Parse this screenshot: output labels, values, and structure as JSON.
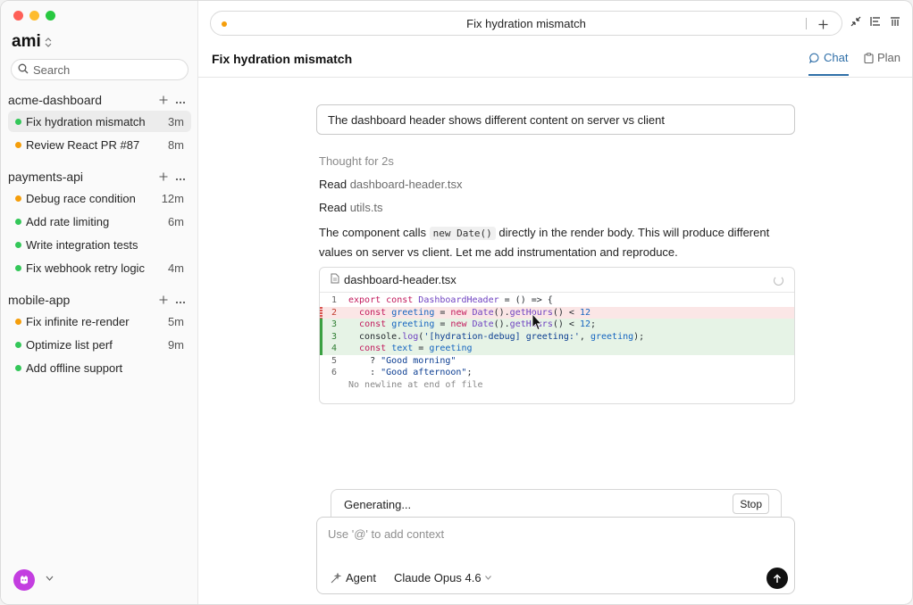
{
  "sidebar": {
    "workspace": "ami",
    "search": {
      "placeholder": "Search"
    },
    "groups": [
      {
        "title": "acme-dashboard",
        "items": [
          {
            "label": "Fix hydration mismatch",
            "time": "3m",
            "status": "green",
            "active": true
          },
          {
            "label": "Review React PR #87",
            "time": "8m",
            "status": "orange"
          }
        ]
      },
      {
        "title": "payments-api",
        "items": [
          {
            "label": "Debug race condition",
            "time": "12m",
            "status": "orange"
          },
          {
            "label": "Add rate limiting",
            "time": "6m",
            "status": "green"
          },
          {
            "label": "Write integration tests",
            "time": "",
            "status": "green"
          },
          {
            "label": "Fix webhook retry logic",
            "time": "4m",
            "status": "green"
          }
        ]
      },
      {
        "title": "mobile-app",
        "items": [
          {
            "label": "Fix infinite re-render",
            "time": "5m",
            "status": "orange"
          },
          {
            "label": "Optimize list perf",
            "time": "9m",
            "status": "green"
          },
          {
            "label": "Add offline support",
            "time": "",
            "status": "green"
          }
        ]
      }
    ]
  },
  "topbar": {
    "title": "Fix hydration mismatch"
  },
  "header": {
    "title": "Fix hydration mismatch",
    "tabs": {
      "chat": "Chat",
      "plan": "Plan"
    }
  },
  "conversation": {
    "prompt": "The dashboard header shows different content on server vs client",
    "thought": "Thought for 2s",
    "reads": [
      {
        "action": "Read",
        "file": "dashboard-header.tsx"
      },
      {
        "action": "Read",
        "file": "utils.ts"
      }
    ],
    "message_pre": "The component calls ",
    "message_code": "new Date()",
    "message_post": " directly in the render body. This will produce different values on server vs client. Let me add instrumentation and reproduce."
  },
  "code_card": {
    "filename": "dashboard-header.tsx",
    "lines": [
      {
        "num": "1",
        "type": "ctx",
        "text": "export const DashboardHeader = () => {"
      },
      {
        "num": "2",
        "type": "del",
        "text": "  const greeting = new Date().getHours() < 12"
      },
      {
        "num": "3",
        "type": "add",
        "text": "  const greeting = new Date().getHours() < 12;"
      },
      {
        "num": "3",
        "type": "add",
        "text": "  console.log('[hydration-debug] greeting:', greeting);"
      },
      {
        "num": "4",
        "type": "add",
        "text": "  const text = greeting"
      },
      {
        "num": "5",
        "type": "ctx",
        "text": "    ? \"Good morning\""
      },
      {
        "num": "6",
        "type": "ctx",
        "text": "    : \"Good afternoon\";"
      },
      {
        "num": "",
        "type": "note",
        "text": "No newline at end of file"
      }
    ]
  },
  "generating": {
    "label": "Generating...",
    "stop": "Stop"
  },
  "composer": {
    "placeholder": "Use '@' to add context",
    "agent": "Agent",
    "model": "Claude Opus 4.6"
  },
  "colors": {
    "green": "#34c759",
    "orange": "#f59e0b",
    "accent": "#2f6fa8",
    "avatar": "#c33ee0"
  }
}
